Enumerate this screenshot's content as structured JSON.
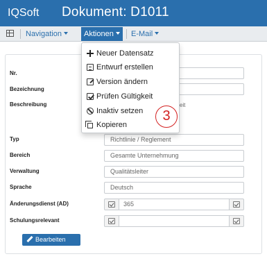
{
  "header": {
    "brand": "IQSoft",
    "title": "Dokument: D1011"
  },
  "navbar": {
    "grid_icon": "grid-icon",
    "items": [
      {
        "label": "Navigation"
      },
      {
        "label": "Aktionen"
      },
      {
        "label": "E-Mail"
      }
    ]
  },
  "form": {
    "fields": [
      {
        "label": "Nr.",
        "value": ""
      },
      {
        "label": "Bezeichnung",
        "value": ""
      },
      {
        "label": "Beschreibung",
        "value": "beitszeit"
      },
      {
        "label": "Typ",
        "value": "Richtlinie / Reglement"
      },
      {
        "label": "Bereich",
        "value": "Gesamte Unternehmung"
      },
      {
        "label": "Verwaltung",
        "value": "Qualitätsleiter"
      },
      {
        "label": "Sprache",
        "value": "Deutsch"
      },
      {
        "label": "Änderungsdienst (AD)",
        "value": "365",
        "checked": true
      },
      {
        "label": "Schulungsrelevant",
        "value": "",
        "checked": true
      }
    ],
    "edit_button": "Bearbeiten"
  },
  "dropdown": {
    "items": [
      {
        "label": "Neuer Datensatz",
        "icon": "plus-icon"
      },
      {
        "label": "Entwurf erstellen",
        "icon": "document-icon"
      },
      {
        "label": "Version ändern",
        "icon": "edit-icon"
      },
      {
        "label": "Prüfen Gültigkeit",
        "icon": "check-square-icon"
      },
      {
        "label": "Inaktiv setzen",
        "icon": "ban-icon"
      },
      {
        "label": "Kopieren",
        "icon": "copy-icon"
      }
    ]
  },
  "annotation": {
    "step": "3",
    "color": "#d32020"
  },
  "colors": {
    "primary": "#2a6fad",
    "navbar_bg": "#e9ecef"
  }
}
